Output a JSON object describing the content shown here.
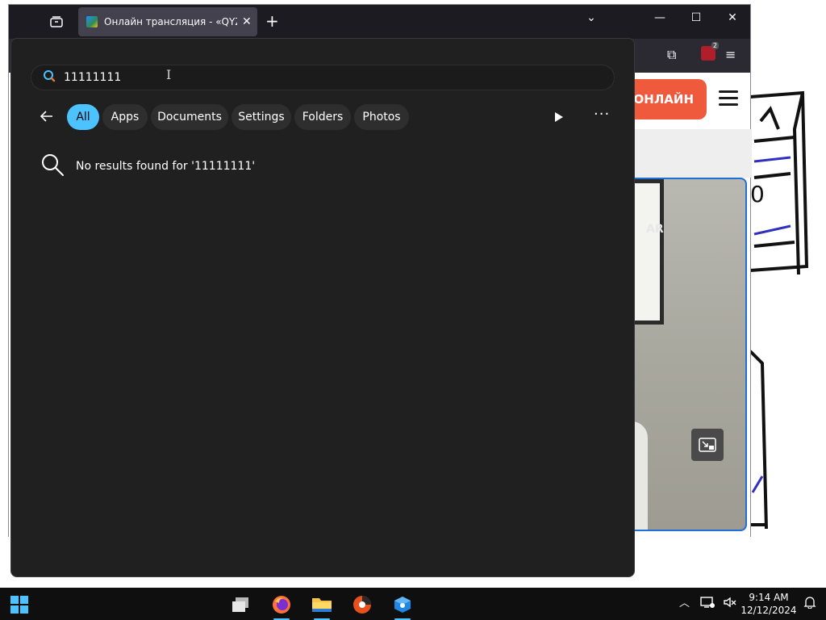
{
  "browser": {
    "tab_title": "Онлайн трансляция - «QYZYL",
    "tab_close_glyph": "✕",
    "new_tab_glyph": "+",
    "list_all_tabs_glyph": "⌄",
    "minimize_glyph": "—",
    "maximize_glyph": "☐",
    "close_glyph": "✕",
    "ublock_badge_count": "2",
    "menu_glyph": "≡",
    "extensions_glyph": "⧉"
  },
  "page": {
    "online_button_label": "ОНЛАЙН",
    "video_brand_text": "AR",
    "accent_color": "#f05a3c"
  },
  "search": {
    "query": "11111111",
    "filters": [
      {
        "label": "All",
        "active": true
      },
      {
        "label": "Apps",
        "active": false
      },
      {
        "label": "Documents",
        "active": false
      },
      {
        "label": "Settings",
        "active": false
      },
      {
        "label": "Folders",
        "active": false
      },
      {
        "label": "Photos",
        "active": false
      }
    ],
    "no_results_text": "No results found for '11111111'",
    "more_glyph": "···",
    "accent_color": "#4cc2ff"
  },
  "taskbar": {
    "apps": [
      "start-icon",
      "task-view-icon",
      "firefox-icon",
      "file-explorer-icon",
      "browser-icon",
      "app-icon"
    ],
    "tray_chevron_glyph": "︿",
    "time": "9:14 AM",
    "date": "12/12/2024"
  }
}
